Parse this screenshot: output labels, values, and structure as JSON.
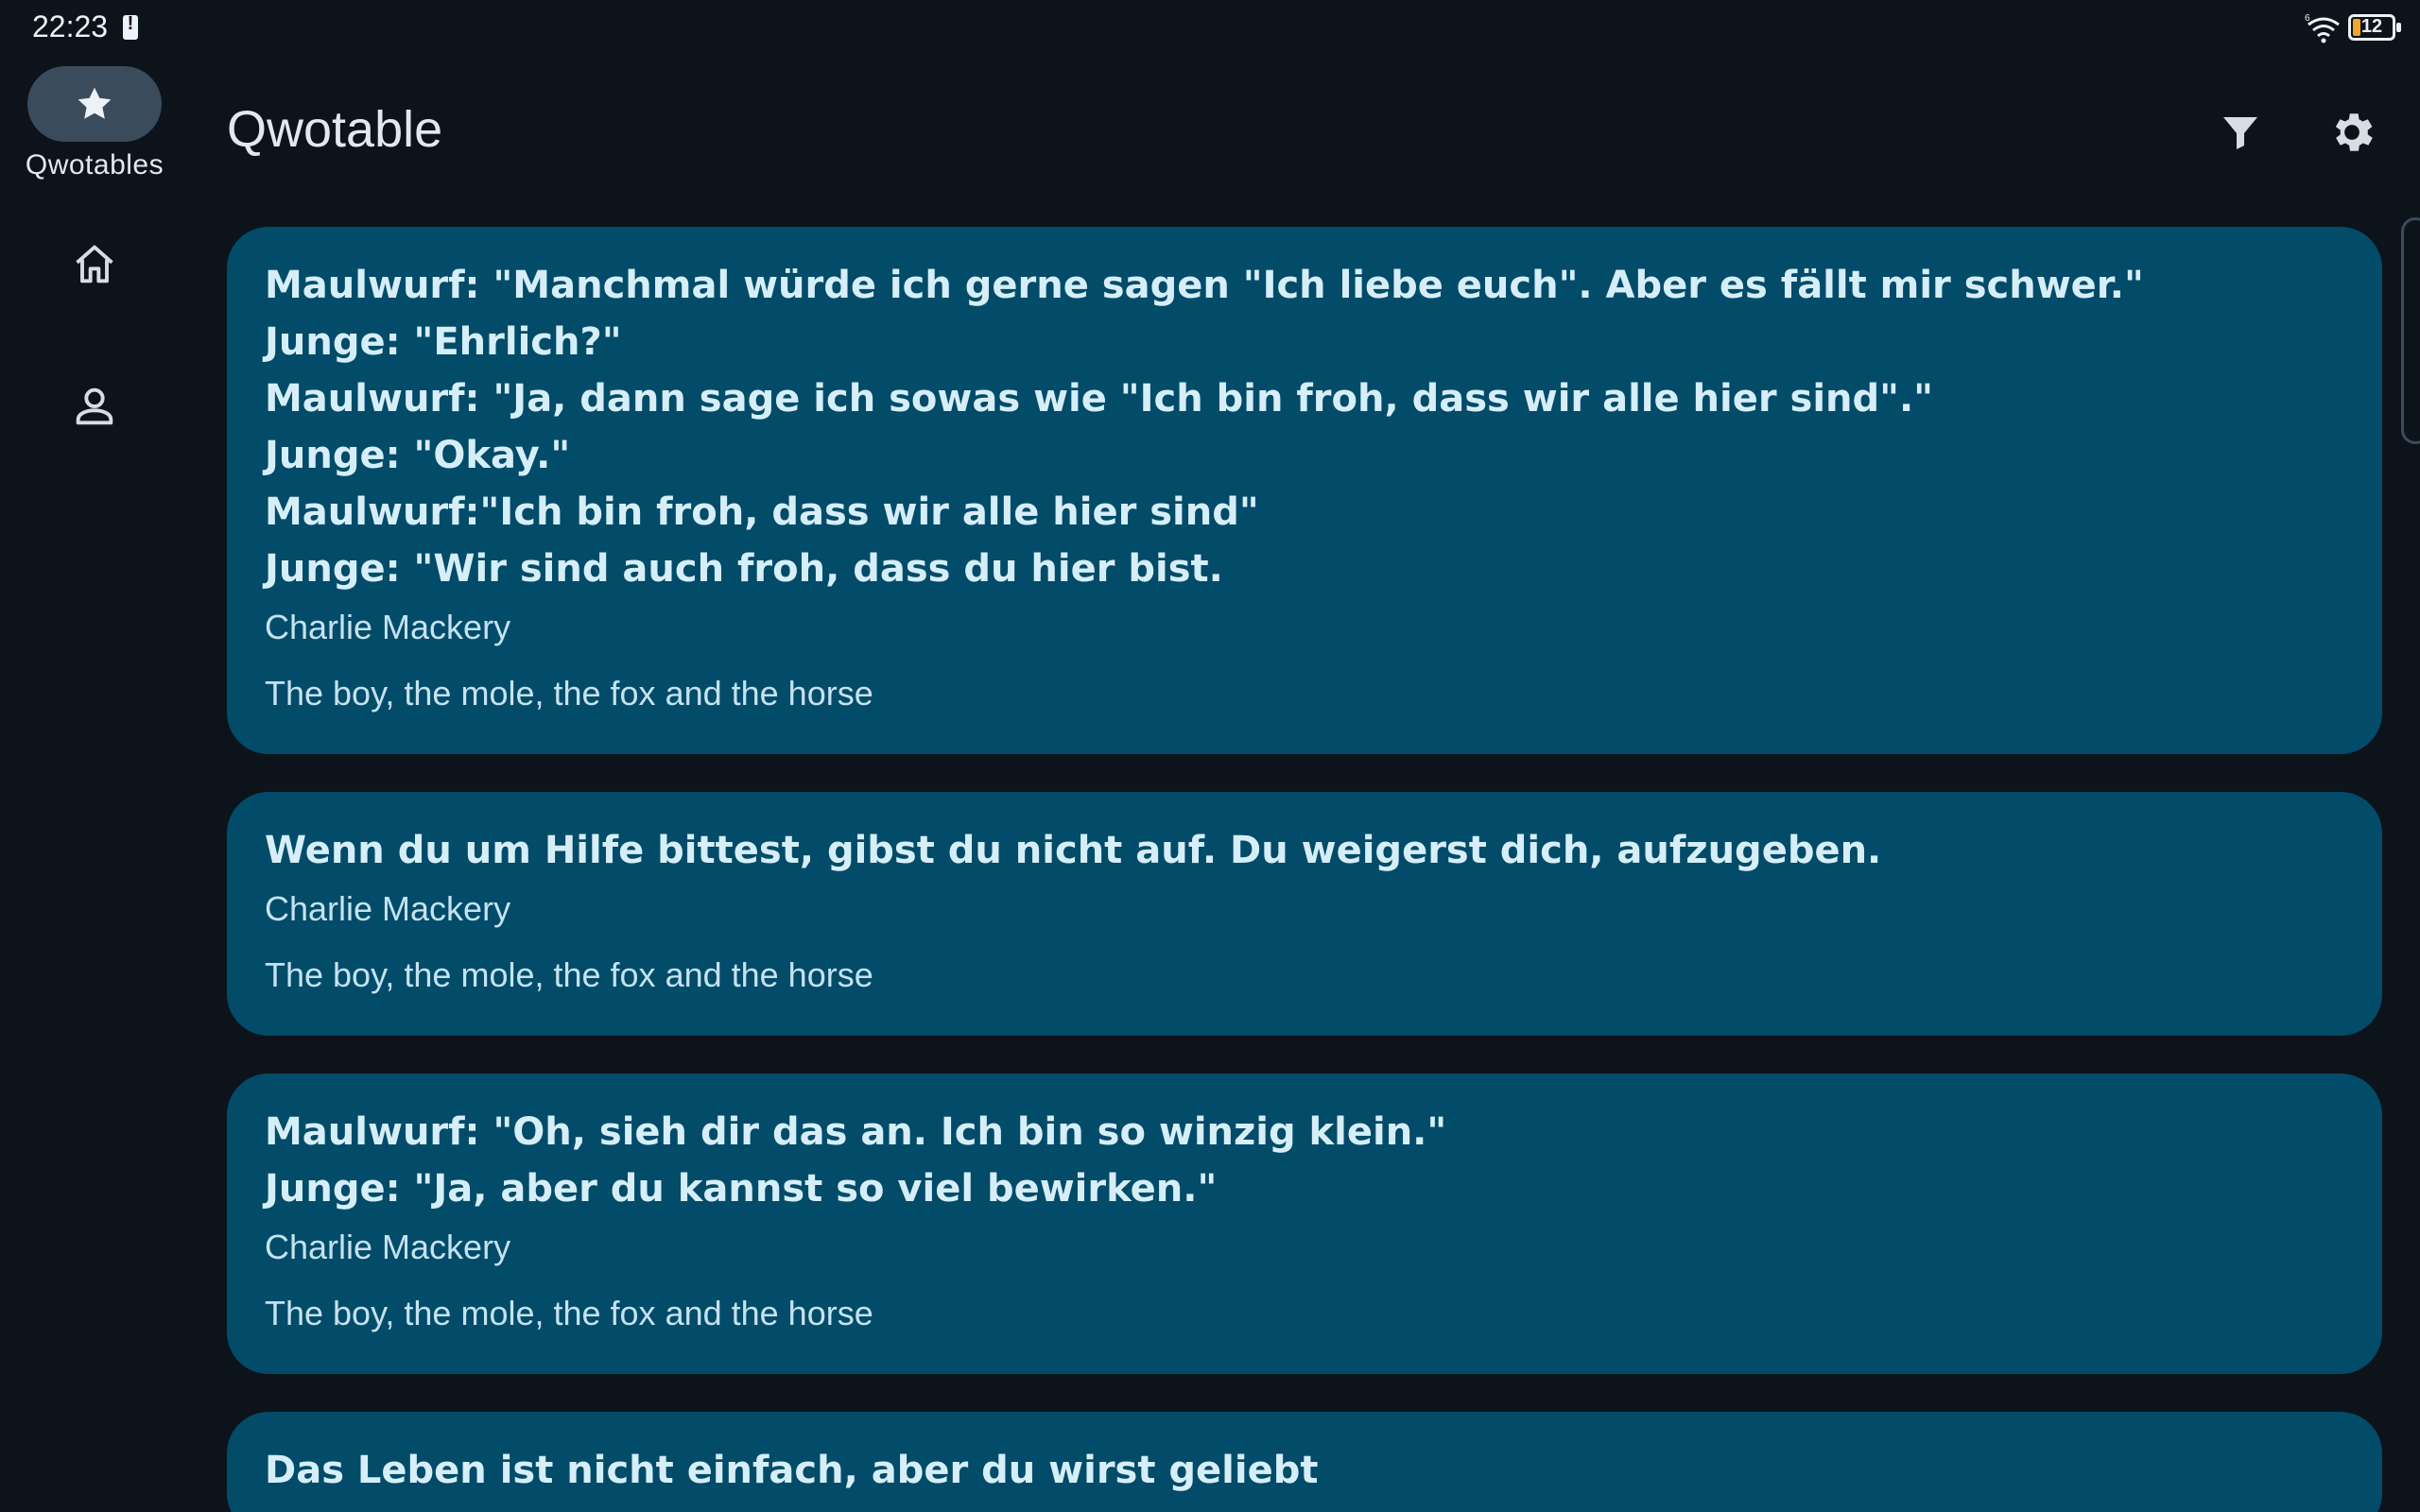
{
  "status": {
    "time": "22:23",
    "battery": "12",
    "network": "6"
  },
  "nav": {
    "items": [
      {
        "label": "Qwotables",
        "icon": "star-icon",
        "active": true
      },
      {
        "label": "",
        "icon": "home-icon",
        "active": false
      },
      {
        "label": "",
        "icon": "person-icon",
        "active": false
      }
    ]
  },
  "app_bar": {
    "title": "Qwotable",
    "actions": [
      "filter-icon",
      "gear-icon"
    ]
  },
  "quotes": [
    {
      "lines": [
        "Maulwurf: \"Manchmal würde ich gerne sagen \"Ich liebe euch\". Aber es fällt mir schwer.\"",
        "Junge: \"Ehrlich?\"",
        "Maulwurf: \"Ja, dann sage ich sowas wie \"Ich bin froh, dass wir alle hier sind\".\"",
        "Junge: \"Okay.\"",
        "Maulwurf:\"Ich bin froh, dass wir alle hier sind\"",
        "Junge: \"Wir sind auch froh, dass du hier bist."
      ],
      "author": "Charlie Mackery",
      "source": "The boy, the mole, the fox and the horse"
    },
    {
      "lines": [
        "Wenn du um Hilfe bittest, gibst du nicht auf. Du weigerst dich, aufzugeben."
      ],
      "author": "Charlie Mackery",
      "source": "The boy, the mole, the fox and the horse"
    },
    {
      "lines": [
        "Maulwurf: \"Oh, sieh dir das an. Ich bin so winzig klein.\"",
        "Junge: \"Ja, aber du kannst so viel bewirken.\""
      ],
      "author": "Charlie Mackery",
      "source": "The boy, the mole, the fox and the horse"
    },
    {
      "lines": [
        "Das Leben ist nicht einfach, aber du wirst geliebt"
      ],
      "author": "",
      "source": ""
    }
  ],
  "colors": {
    "background": "#0d131b",
    "card": "#024b69",
    "rail_indicator": "#3a4b5c",
    "text": "#e2e8ee"
  }
}
